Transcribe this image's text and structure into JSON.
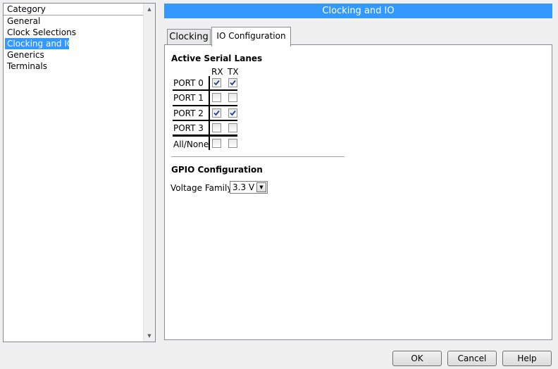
{
  "category": {
    "header": "Category",
    "items": [
      "General",
      "Clock Selections",
      "Clocking and IO",
      "Generics",
      "Terminals"
    ],
    "selected": "Clocking and IO"
  },
  "header": {
    "title": "Clocking and IO"
  },
  "tabs": [
    {
      "label": "Clocking",
      "active": false
    },
    {
      "label": "IO Configuration",
      "active": true
    }
  ],
  "serial_lanes": {
    "title": "Active Serial Lanes",
    "col_rx": "RX",
    "col_tx": "TX",
    "ports": [
      {
        "label": "PORT 0",
        "rx": true,
        "tx": true
      },
      {
        "label": "PORT 1",
        "rx": false,
        "tx": false
      },
      {
        "label": "PORT 2",
        "rx": true,
        "tx": true
      },
      {
        "label": "PORT 3",
        "rx": false,
        "tx": false
      }
    ],
    "all_none": {
      "label": "All/None",
      "rx": false,
      "tx": false
    }
  },
  "gpio": {
    "title": "GPIO Configuration",
    "voltage_label": "Voltage Family",
    "voltage_value": "3.3 V"
  },
  "buttons": {
    "ok": "OK",
    "cancel": "Cancel",
    "help": "Help"
  },
  "icons": {
    "scroll_up": "scroll-up-arrow-icon",
    "scroll_down": "scroll-down-arrow-icon",
    "dropdown": "chevron-down-icon",
    "check": "checkmark-icon"
  },
  "colors": {
    "accent": "#3399ff",
    "check": "#1f3f8f"
  }
}
